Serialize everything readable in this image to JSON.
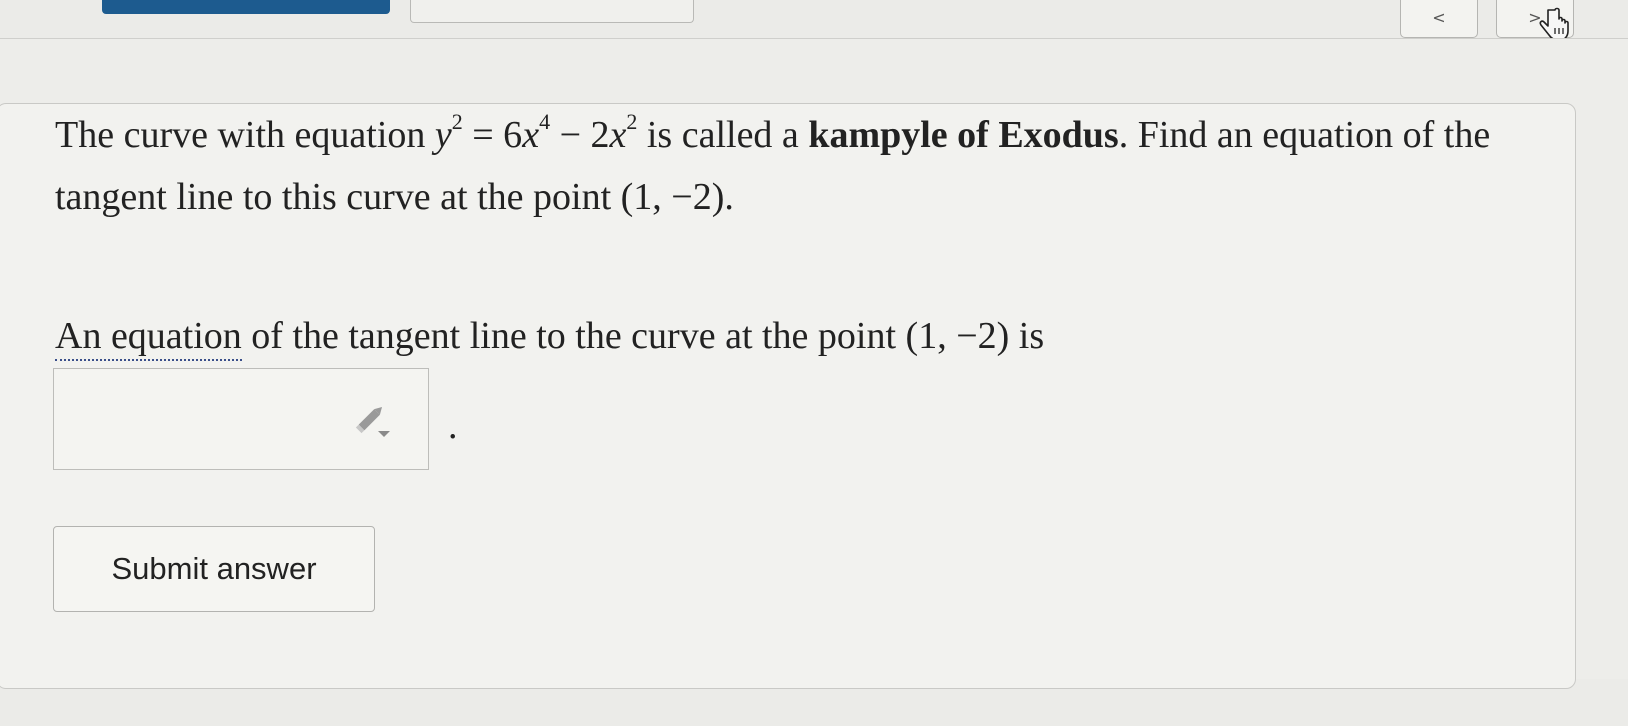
{
  "nav": {
    "prev_label": "<",
    "next_label": ">"
  },
  "question": {
    "intro": "The curve with equation ",
    "eq_y": "y",
    "eq_y_exp": "2",
    "eq_equals": " = 6",
    "eq_x1": "x",
    "eq_x1_exp": "4",
    "eq_minus": " − 2",
    "eq_x2": "x",
    "eq_x2_exp": "2",
    "mid": " is called a ",
    "term": "kampyle of Exodus",
    "rest": ". Find an equation of the tangent line to this curve at the point (1, −2)."
  },
  "answer": {
    "prefix_underlined": "An equation",
    "rest": " of the tangent line to the curve at the point (1, −2) is",
    "input_value": "",
    "period": "."
  },
  "submit": {
    "label": "Submit answer"
  },
  "icons": {
    "edit": "pencil-dropdown-icon",
    "cursor": "hand-pointer-icon"
  },
  "colors": {
    "accent": "#1d5b8f",
    "underline": "#3a4f8a"
  }
}
